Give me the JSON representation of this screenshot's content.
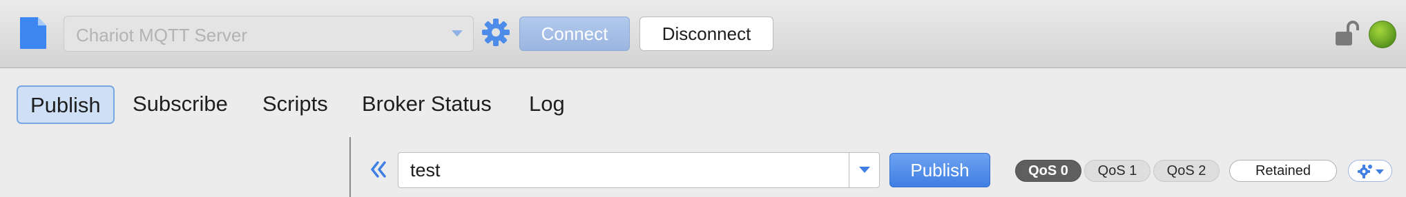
{
  "toolbar": {
    "document_icon": "document-icon",
    "server_select": {
      "value": "Chariot MQTT Server",
      "disabled": true
    },
    "settings_icon": "gear-icon",
    "connect_label": "Connect",
    "disconnect_label": "Disconnect",
    "lock_icon": "unlocked-lock-icon",
    "status_icon": "connection-status-light",
    "colors": {
      "accent": "#3f7ee3",
      "doc_icon": "#3d86f0",
      "status_green": "#6aa524"
    }
  },
  "tabs": [
    {
      "label": "Publish",
      "active": true
    },
    {
      "label": "Subscribe",
      "active": false
    },
    {
      "label": "Scripts",
      "active": false
    },
    {
      "label": "Broker Status",
      "active": false
    },
    {
      "label": "Log",
      "active": false
    }
  ],
  "publish": {
    "collapse_icon": "double-chevron-left-icon",
    "topic_value": "test",
    "topic_dropdown_icon": "chevron-down-icon",
    "publish_label": "Publish",
    "qos": [
      {
        "label": "QoS 0",
        "selected": true
      },
      {
        "label": "QoS 1",
        "selected": false
      },
      {
        "label": "QoS 2",
        "selected": false
      }
    ],
    "retained_label": "Retained",
    "options_icon": "gear-dropdown-icon"
  }
}
